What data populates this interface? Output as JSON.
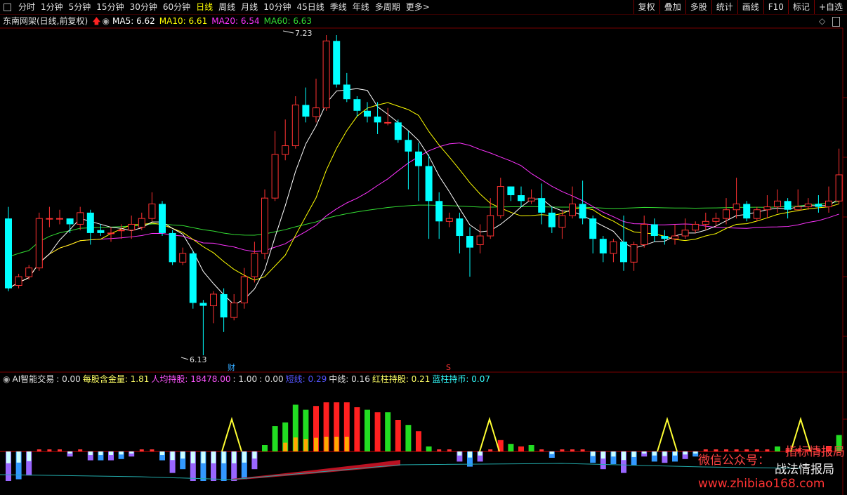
{
  "toolbar": {
    "tabs": [
      "分时",
      "1分钟",
      "5分钟",
      "15分钟",
      "30分钟",
      "60分钟",
      "日线",
      "周线",
      "月线",
      "10分钟",
      "45日线",
      "季线",
      "年线",
      "多周期",
      "更多>"
    ],
    "active_tab": "日线",
    "right_buttons": [
      "复权",
      "叠加",
      "多股",
      "统计",
      "画线",
      "F10",
      "标记",
      "+自选"
    ]
  },
  "info": {
    "stock_title": "东南网架(日线,前复权)",
    "ma": [
      {
        "label": "MA5: 6.62",
        "color": "#ffffff"
      },
      {
        "label": "MA10: 6.61",
        "color": "#ffff00"
      },
      {
        "label": "MA20: 6.54",
        "color": "#ff33ff"
      },
      {
        "label": "MA60: 6.63",
        "color": "#33dd33"
      }
    ]
  },
  "chart_data": {
    "type": "candlestick",
    "high_label": "7.23",
    "low_label": "6.13",
    "markers": [
      "财",
      "S"
    ],
    "candles": [
      [
        6.6,
        6.36,
        6.64,
        6.35
      ],
      [
        6.37,
        6.4,
        6.41,
        6.36
      ],
      [
        6.4,
        6.43,
        6.44,
        6.39
      ],
      [
        6.43,
        6.6,
        6.62,
        6.42
      ],
      [
        6.6,
        6.6,
        6.64,
        6.57
      ],
      [
        6.6,
        6.6,
        6.63,
        6.58
      ],
      [
        6.6,
        6.58,
        6.6,
        6.55
      ],
      [
        6.58,
        6.62,
        6.64,
        6.56
      ],
      [
        6.62,
        6.55,
        6.63,
        6.51
      ],
      [
        6.56,
        6.55,
        6.58,
        6.54
      ],
      [
        6.55,
        6.55,
        6.57,
        6.52
      ],
      [
        6.56,
        6.56,
        6.58,
        6.53
      ],
      [
        6.56,
        6.58,
        6.61,
        6.53
      ],
      [
        6.57,
        6.6,
        6.62,
        6.56
      ],
      [
        6.6,
        6.65,
        6.69,
        6.59
      ],
      [
        6.65,
        6.55,
        6.66,
        6.54
      ],
      [
        6.55,
        6.45,
        6.56,
        6.44
      ],
      [
        6.45,
        6.48,
        6.5,
        6.44
      ],
      [
        6.48,
        6.31,
        6.49,
        6.29
      ],
      [
        6.31,
        6.3,
        6.32,
        6.13
      ],
      [
        6.3,
        6.34,
        6.35,
        6.24
      ],
      [
        6.34,
        6.26,
        6.36,
        6.21
      ],
      [
        6.26,
        6.31,
        6.34,
        6.25
      ],
      [
        6.31,
        6.4,
        6.43,
        6.29
      ],
      [
        6.4,
        6.48,
        6.52,
        6.38
      ],
      [
        6.48,
        6.67,
        6.7,
        6.46
      ],
      [
        6.67,
        6.82,
        6.9,
        6.66
      ],
      [
        6.82,
        6.85,
        6.94,
        6.8
      ],
      [
        6.85,
        6.99,
        7.02,
        6.84
      ],
      [
        6.99,
        6.95,
        7.05,
        6.93
      ],
      [
        6.95,
        6.98,
        7.08,
        6.93
      ],
      [
        6.98,
        7.21,
        7.23,
        6.97
      ],
      [
        7.21,
        7.06,
        7.23,
        7.05
      ],
      [
        7.06,
        7.01,
        7.1,
        7.0
      ],
      [
        7.01,
        6.97,
        7.02,
        6.95
      ],
      [
        6.97,
        6.95,
        7.0,
        6.93
      ],
      [
        6.95,
        6.93,
        7.0,
        6.89
      ],
      [
        6.93,
        6.93,
        6.98,
        6.92
      ],
      [
        6.93,
        6.87,
        6.94,
        6.86
      ],
      [
        6.87,
        6.83,
        6.9,
        6.7
      ],
      [
        6.83,
        6.78,
        6.86,
        6.66
      ],
      [
        6.78,
        6.66,
        6.82,
        6.53
      ],
      [
        6.66,
        6.59,
        6.69,
        6.53
      ],
      [
        6.59,
        6.6,
        6.62,
        6.57
      ],
      [
        6.6,
        6.54,
        6.62,
        6.48
      ],
      [
        6.54,
        6.5,
        6.57,
        6.4
      ],
      [
        6.51,
        6.54,
        6.58,
        6.48
      ],
      [
        6.54,
        6.61,
        6.67,
        6.53
      ],
      [
        6.61,
        6.71,
        6.74,
        6.6
      ],
      [
        6.71,
        6.68,
        6.71,
        6.66
      ],
      [
        6.68,
        6.66,
        6.71,
        6.64
      ],
      [
        6.66,
        6.67,
        6.7,
        6.65
      ],
      [
        6.67,
        6.62,
        6.72,
        6.58
      ],
      [
        6.62,
        6.57,
        6.64,
        6.55
      ],
      [
        6.57,
        6.61,
        6.63,
        6.53
      ],
      [
        6.61,
        6.65,
        6.71,
        6.6
      ],
      [
        6.65,
        6.6,
        6.73,
        6.58
      ],
      [
        6.6,
        6.53,
        6.61,
        6.48
      ],
      [
        6.53,
        6.48,
        6.54,
        6.45
      ],
      [
        6.48,
        6.52,
        6.53,
        6.45
      ],
      [
        6.52,
        6.45,
        6.61,
        6.42
      ],
      [
        6.45,
        6.51,
        6.52,
        6.42
      ],
      [
        6.51,
        6.58,
        6.61,
        6.5
      ],
      [
        6.58,
        6.54,
        6.6,
        6.52
      ],
      [
        6.54,
        6.53,
        6.56,
        6.51
      ],
      [
        6.53,
        6.54,
        6.58,
        6.51
      ],
      [
        6.54,
        6.56,
        6.6,
        6.53
      ],
      [
        6.56,
        6.58,
        6.59,
        6.55
      ],
      [
        6.58,
        6.59,
        6.62,
        6.56
      ],
      [
        6.59,
        6.6,
        6.62,
        6.57
      ],
      [
        6.6,
        6.63,
        6.67,
        6.58
      ],
      [
        6.63,
        6.65,
        6.74,
        6.6
      ],
      [
        6.65,
        6.6,
        6.66,
        6.59
      ],
      [
        6.6,
        6.63,
        6.64,
        6.59
      ],
      [
        6.63,
        6.64,
        6.68,
        6.6
      ],
      [
        6.64,
        6.66,
        6.7,
        6.62
      ],
      [
        6.66,
        6.63,
        6.67,
        6.6
      ],
      [
        6.63,
        6.64,
        6.7,
        6.63
      ],
      [
        6.64,
        6.65,
        6.67,
        6.63
      ],
      [
        6.65,
        6.64,
        6.68,
        6.62
      ],
      [
        6.64,
        6.66,
        6.71,
        6.62
      ],
      [
        6.66,
        6.75,
        6.84,
        6.65
      ]
    ],
    "ma_series": [
      {
        "label": "MA5",
        "color": "#ffffff"
      },
      {
        "label": "MA10",
        "color": "#ffff00"
      },
      {
        "label": "MA20",
        "color": "#ff33ff"
      },
      {
        "label": "MA60",
        "color": "#33dd33"
      }
    ]
  },
  "indicator": {
    "items": [
      {
        "text": "AI智能交易",
        "color": "#e0e0e0"
      },
      {
        "text": ": 0.00",
        "color": "#e0e0e0"
      },
      {
        "text": "每股含金量: 1.81",
        "color": "#ffff66"
      },
      {
        "text": "人均持股: 18478.00",
        "color": "#ff55ff"
      },
      {
        "text": ": 1.00",
        "color": "#e0e0e0"
      },
      {
        "text": ": 0.00",
        "color": "#e0e0e0"
      },
      {
        "text": "短线: 0.29",
        "color": "#5555ff"
      },
      {
        "text": "中线: 0.16",
        "color": "#e0e0e0"
      },
      {
        "text": "红柱持股: 0.21",
        "color": "#ffff66"
      },
      {
        "text": "蓝柱持币: 0.07",
        "color": "#33ffff"
      }
    ]
  },
  "watermark": {
    "line1": "微信公众号：",
    "line1b": "指标情报局",
    "line2": "战法情报局",
    "url": "www.zhibiao168.com"
  }
}
